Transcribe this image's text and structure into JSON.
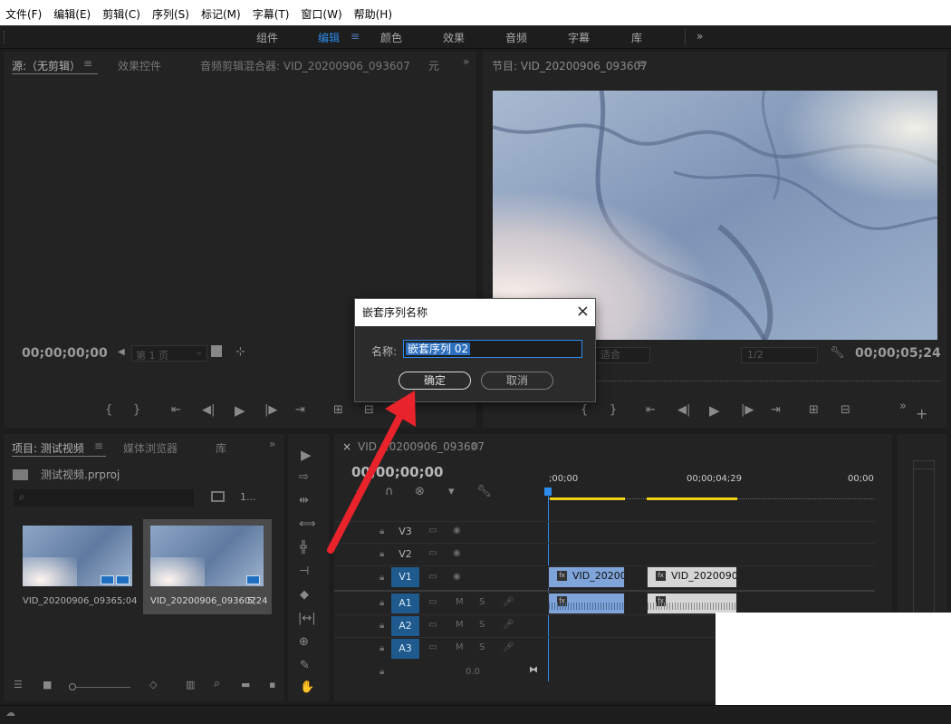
{
  "menu": [
    "文件(F)",
    "编辑(E)",
    "剪辑(C)",
    "序列(S)",
    "标记(M)",
    "字幕(T)",
    "窗口(W)",
    "帮助(H)"
  ],
  "workspaces": [
    "组件",
    "编辑",
    "颜色",
    "效果",
    "音频",
    "字幕",
    "库"
  ],
  "source_panel": {
    "tabs": [
      "源:（无剪辑）",
      "效果控件",
      "音频剪辑混合器: VID_20200906_093607",
      "元"
    ],
    "timecode": "00;00;00;00",
    "page_select": "第 1 页"
  },
  "program_panel": {
    "tab": "节目: VID_20200906_093607",
    "timecode": "00;00;05;24",
    "fit_select": "适合",
    "res_select": "1/2"
  },
  "project_panel": {
    "tabs": [
      "项目: 测试视频",
      "媒体浏览器",
      "库"
    ],
    "project_file": "测试视频.prproj",
    "item_count": "1...",
    "items": [
      {
        "name": "VID_20200906_0936...",
        "duration": "5;04"
      },
      {
        "name": "VID_20200906_093607",
        "duration": "5;24"
      }
    ]
  },
  "timeline": {
    "tab": "VID_20200906_093607",
    "timecode": "00;00;00;00",
    "ruler": [
      ";00;00",
      "00;00;04;29",
      "00;00"
    ],
    "video_tracks": [
      "V3",
      "V2",
      "V1"
    ],
    "audio_tracks": [
      "A1",
      "A2",
      "A3"
    ],
    "master_value": "0.0",
    "clips": [
      "VID_20200",
      "VID_20200906"
    ]
  },
  "dialog": {
    "title": "嵌套序列名称",
    "name_label": "名称:",
    "name_value": "嵌套序列 02",
    "ok_label": "确定",
    "cancel_label": "取消"
  },
  "colors": {
    "accent": "#2d8ceb",
    "track_active": "#1e5a8e",
    "annotation_arrow": "#e8232b",
    "clip_video": "#7fa4d9",
    "work_area": "#f5d21a"
  }
}
